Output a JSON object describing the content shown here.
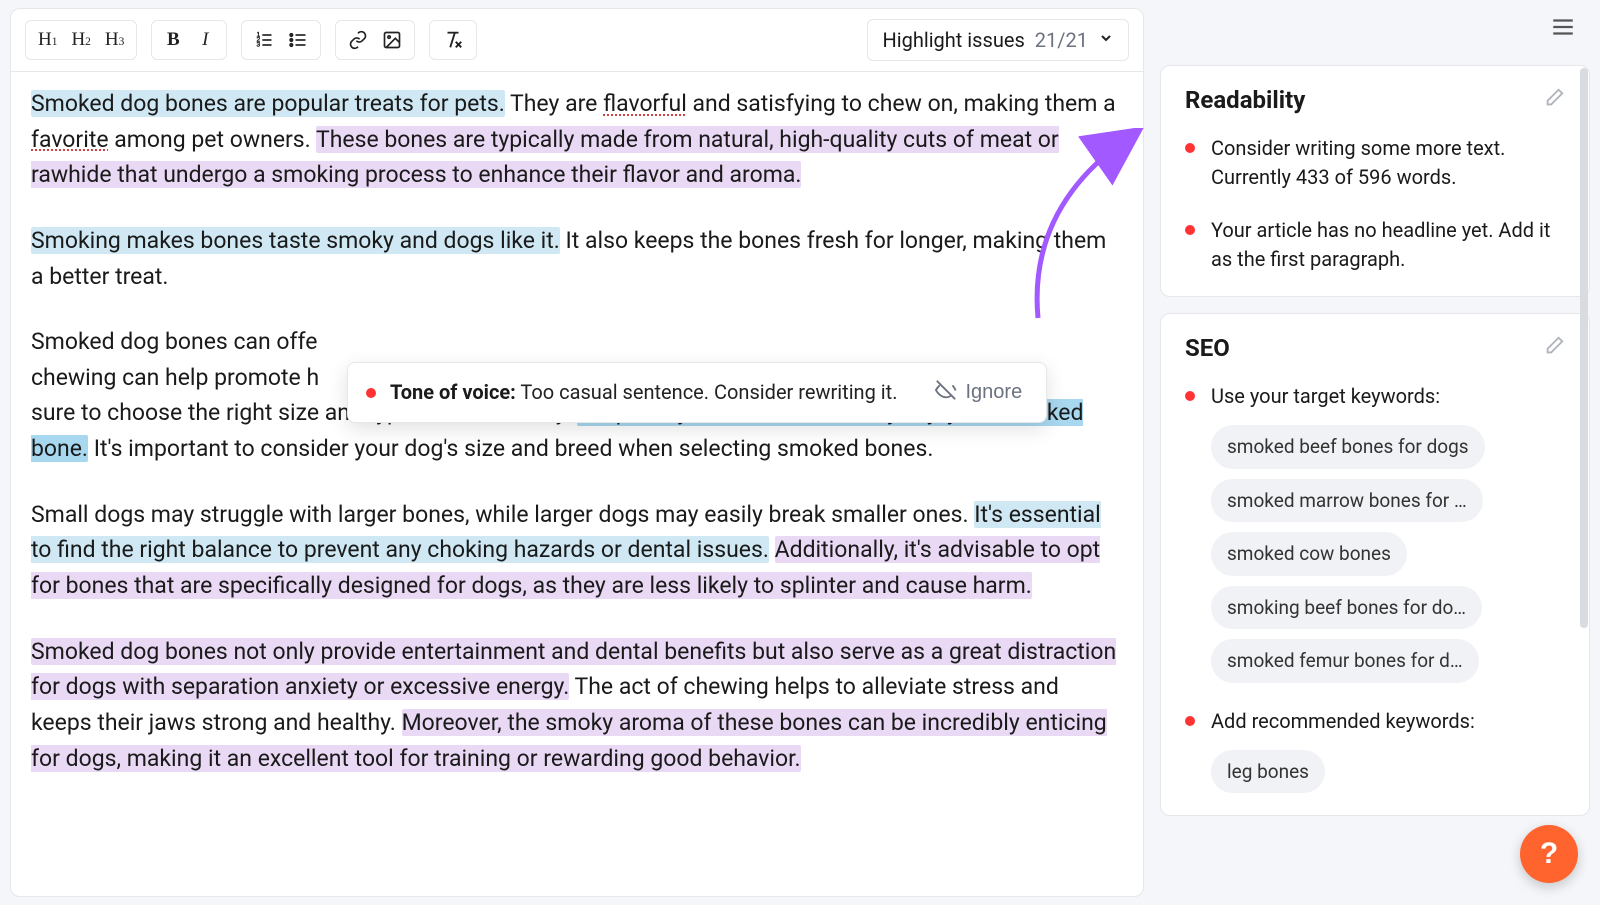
{
  "toolbar": {
    "h1": "H",
    "h1_sub": "1",
    "h2": "H",
    "h2_sub": "2",
    "h3": "H",
    "h3_sub": "3",
    "bold": "B",
    "italic": "I",
    "highlight_label": "Highlight issues",
    "highlight_count": "21/21"
  },
  "content": {
    "p1_a": "Smoked dog bones are popular treats for pets.",
    "p1_b": " They are ",
    "p1_c": "flavorful",
    "p1_d": " and satisfying to chew on, making them a ",
    "p1_e": "favorite",
    "p1_f": " among pet owners. ",
    "p1_g": "These bones are typically made from natural, high-quality cuts of meat or rawhide that undergo a smoking process to enhance their flavor and aroma.",
    "p2_a": "Smoking makes bones taste smoky and dogs like it.",
    "p2_b": " It also keeps the bones fresh for longer, making them a better treat.",
    "p3_a": "Smoked dog bones can offe",
    "p3_b": "chewing can help promote h",
    "p3_c": "sure to choose the right size and type for their safety. ",
    "p3_d": "Keep an eye on them while they enjoy the smoked bone.",
    "p3_e": " It's important to consider your dog's size and breed when selecting smoked bones.",
    "p4_a": "Small dogs may struggle with larger bones, while larger dogs may easily break smaller ones. ",
    "p4_b": "It's essential to find the right balance to prevent any choking hazards or dental issues.",
    "p4_c": " ",
    "p4_d": "Additionally, it's advisable to opt for bones that are specifically designed for dogs, as they are less likely to splinter and cause harm.",
    "p5_a": "Smoked dog bones not only provide entertainment and dental benefits but also serve as a great distraction for dogs with separation anxiety or excessive energy.",
    "p5_b": " The act of chewing helps to alleviate stress and keeps their jaws strong and healthy. ",
    "p5_c": "Moreover, the smoky aroma of these bones can be incredibly enticing for dogs, making it an excellent tool for training or rewarding good behavior."
  },
  "popup": {
    "label": "Tone of voice:",
    "message": "Too casual sentence. Consider rewriting it.",
    "ignore": "Ignore"
  },
  "sidebar": {
    "readability": {
      "title": "Readability",
      "issues": [
        "Consider writing some more text. Currently 433 of 596 words.",
        "Your article has no headline yet. Add it as the first paragraph."
      ]
    },
    "seo": {
      "title": "SEO",
      "issue_keywords_label": "Use your target keywords:",
      "target_keywords": [
        "smoked beef bones for dogs",
        "smoked marrow bones for …",
        "smoked cow bones",
        "smoking beef bones for do…",
        "smoked femur bones for d…"
      ],
      "issue_recommended_label": "Add recommended keywords:",
      "recommended_keywords": [
        "leg bones"
      ]
    }
  },
  "help": "?"
}
